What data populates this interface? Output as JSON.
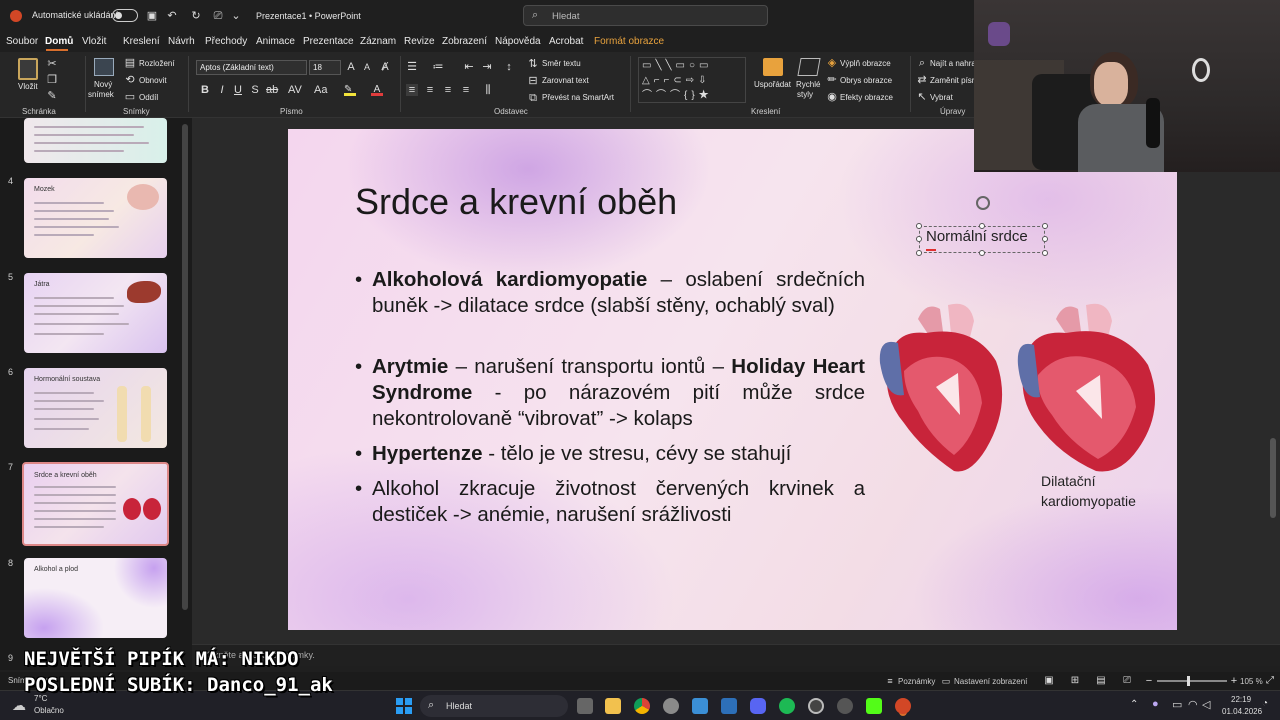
{
  "titlebar": {
    "autosave_label": "Automatické ukládání",
    "window_title": "Prezentace1 • PowerPoint",
    "search_placeholder": "Hledat"
  },
  "menu": {
    "tabs": [
      "Soubor",
      "Domů",
      "Vložit",
      "Kreslení",
      "Návrh",
      "Přechody",
      "Animace",
      "Prezentace",
      "Záznam",
      "Revize",
      "Zobrazení",
      "Nápověda",
      "Acrobat",
      "Formát obrazce"
    ],
    "active_tab": "Domů"
  },
  "ribbon": {
    "groups": {
      "clipboard": "Schránka",
      "slides": "Snímky",
      "font": "Písmo",
      "paragraph": "Odstavec",
      "drawing": "Kreslení",
      "editing": "Úpravy"
    },
    "paste": "Vložit",
    "new_slide_1": "Nový",
    "new_slide_2": "snímek",
    "layout": "Rozložení",
    "reset": "Obnovit",
    "section": "Oddíl",
    "font_name": "Aptos (Základní text)",
    "font_size": "18",
    "text_direction": "Směr textu",
    "align_text": "Zarovnat text",
    "smartart": "Převést na SmartArt",
    "arrange": "Uspořádat",
    "quick_styles_1": "Rychlé",
    "quick_styles_2": "styly",
    "shape_fill": "Výplň obrazce",
    "shape_outline": "Obrys obrazce",
    "shape_effects": "Efekty obrazce",
    "find": "Najít a nahra",
    "replace": "Zaměnit písm",
    "select": "Vybrat"
  },
  "thumbnails": [
    {
      "num": "4",
      "title": "Mozek"
    },
    {
      "num": "5",
      "title": "Játra"
    },
    {
      "num": "6",
      "title": "Hormonální soustava"
    },
    {
      "num": "7",
      "title": "Srdce a krevní oběh"
    },
    {
      "num": "8",
      "title": "Alkohol a plod"
    },
    {
      "num": "9",
      "title": ""
    }
  ],
  "slide": {
    "title": "Srdce a krevní oběh",
    "b1_bold": "Alkoholová kardiomyopatie",
    "b1_rest": " – oslabení srdečních buněk -> dilatace srdce (slabší stěny, ochablý sval)",
    "b2_bold1": "Arytmie",
    "b2_mid": " – narušení transportu iontů – ",
    "b2_bold2": "Holiday Heart Syndrome",
    "b2_rest": " - po nárazovém pití může srdce nekontrolovaně “vibrovat” -> kolaps",
    "b3_bold": "Hypertenze",
    "b3_rest": " - tělo je ve stresu, cévy se stahují",
    "b4": "Alkohol zkracuje životnost červených krvinek a destiček -> anémie, narušení srážlivosti",
    "caption_normal": "Normální srdce",
    "caption_dilated_1": "Dilatační",
    "caption_dilated_2": "kardiomyopatie"
  },
  "notes_placeholder": "Klikněte a vložte poznámky.",
  "overlay": {
    "line1": "NEJVĚTŠÍ PIPÍK MÁ: NIKDO",
    "line2": "POSLEDNÍ SUBÍK: Danco_91_ak"
  },
  "statusbar": {
    "slide_info": "Snímek 7 z 9",
    "notes": "Poznámky",
    "view_settings": "Nastavení zobrazení",
    "zoom": "105 %"
  },
  "taskbar": {
    "weather_temp": "7°C",
    "weather_desc": "Oblačno",
    "search": "Hledat",
    "time": "22:19",
    "date": "01.04.2026"
  },
  "colors": {
    "heart_red": "#c8243a",
    "accent_orange": "#d86f2d",
    "format_tab": "#e8a23d"
  }
}
